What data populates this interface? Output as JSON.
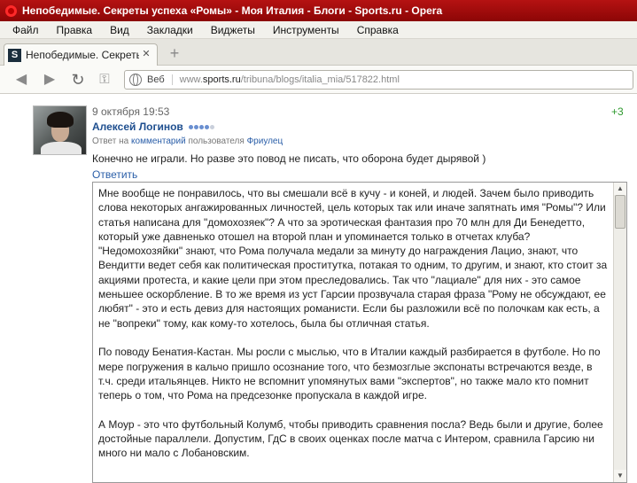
{
  "window": {
    "title": "Непобедимые. Секреты успеха «Ромы» - Моя Италия - Блоги - Sports.ru - Opera"
  },
  "menu": [
    "Файл",
    "Правка",
    "Вид",
    "Закладки",
    "Виджеты",
    "Инструменты",
    "Справка"
  ],
  "tab": {
    "favicon": "S",
    "title": "Непобедимые. Секреты...",
    "close": "✕",
    "new_tab": "+"
  },
  "nav": {
    "back": "◀",
    "forward": "▶",
    "reload": "↻",
    "key": "⚿",
    "site_label": "Веб",
    "url_prefix": "www.",
    "url_domain": "sports.ru",
    "url_path": "/tribuna/blogs/italia_mia/517822.html"
  },
  "comment": {
    "date": "9 октября 19:53",
    "rating": "+3",
    "author": "Алексей Логинов",
    "rank_dots": [
      "#6a8fd0",
      "#6a8fd0",
      "#6a8fd0",
      "#6a8fd0",
      "#c9cfdb"
    ],
    "reply_prefix": "Ответ на",
    "reply_link": "комментарий",
    "reply_mid": "пользователя",
    "reply_user": "Фриулец",
    "text": "Конечно не играли. Но разве это повод не писать, что оборона будет дырявой )",
    "reply_action": "Ответить"
  },
  "textarea": {
    "paragraphs": [
      "Мне вообще не понравилось, что вы смешали всё в кучу - и коней, и людей. Зачем было приводить слова некоторых ангажированных личностей, цель которых так или иначе запятнать имя \"Ромы\"? Или статья написана для \"домохозяек\"? А что за эротическая фантазия про 70 млн для Ди Бенедетто, который уже давненько отошел на второй план и упоминается только в отчетах клуба? \"Недомохозяйки\" знают, что Рома получала медали за минуту до награждения Лацио, знают, что Вендитти ведет себя как политическая проститутка, потакая то одним, то другим, и знают, кто стоит за акциями протеста, и какие цели при этом преследовались. Так что \"лациале\" для них - это самое меньшее оскорбление. В то же время из уст Гарсии прозвучала старая фраза \"Рому не обсуждают, ее любят\" - это и есть девиз для настоящих романисти. Если бы разложили всё по полочкам как есть, а не \"вопреки\" тому, как кому-то хотелось, была бы отличная статья.",
      "По поводу Бенатия-Кастан. Мы росли с мыслью, что в Италии каждый разбирается в футболе. Но по мере погружения в кальчо пришло осознание того, что безмозглые экспонаты встречаются везде, в т.ч. среди итальянцев. Никто не вспомнит упомянутых вами \"экспертов\", но также мало кто помнит теперь о том, что Рома на предсезонке пропускала в каждой игре.",
      "А Моур - это что футбольный Колумб, чтобы приводить сравнения посла? Ведь были и другие, более достойные параллели. Допустим, ГдС в своих оценках после матча с Интером, сравнила Гарсию ни много ни мало с Лобановским."
    ]
  }
}
